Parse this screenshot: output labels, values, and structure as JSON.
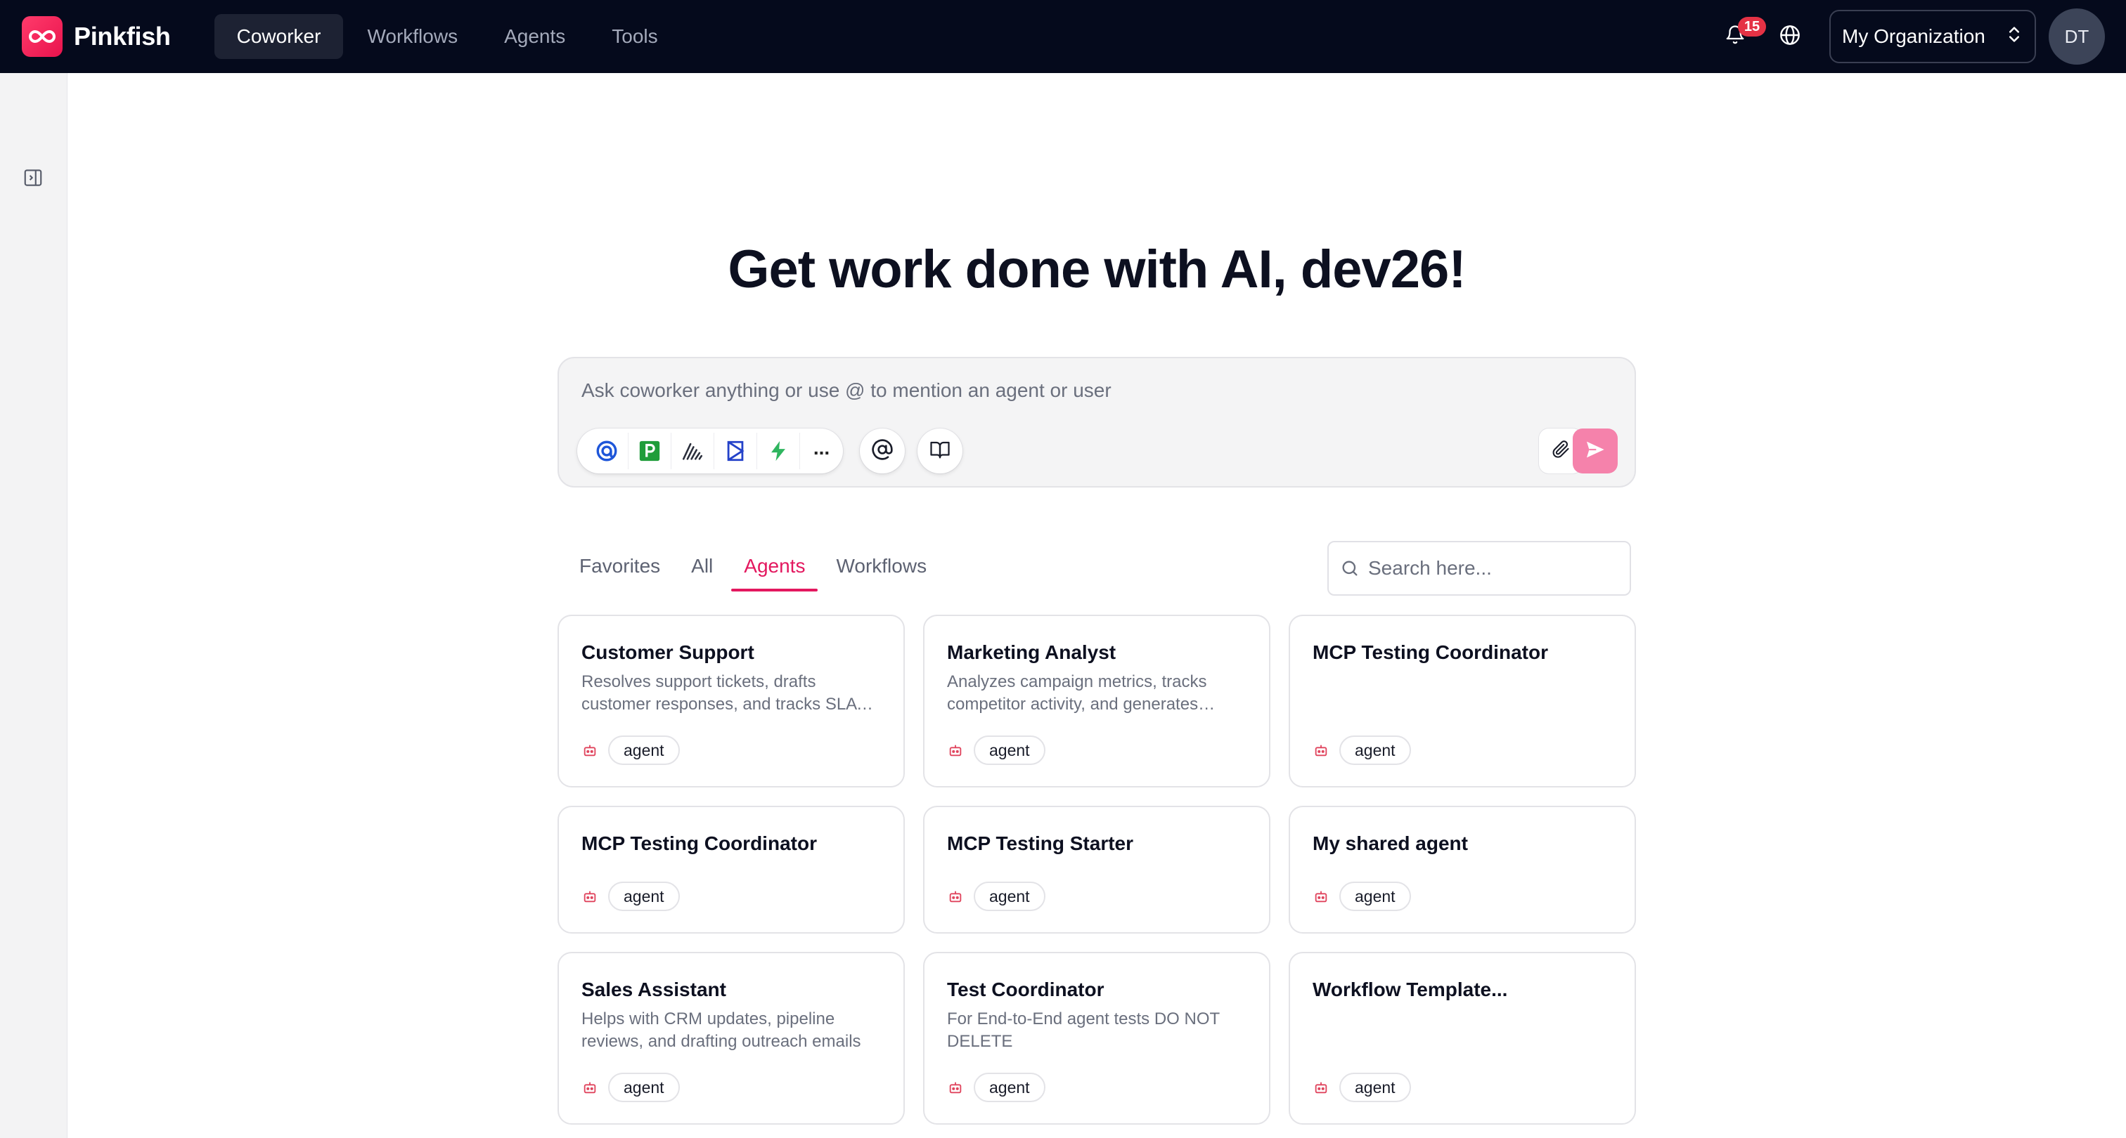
{
  "brand": {
    "name": "Pinkfish"
  },
  "nav": {
    "items": [
      {
        "label": "Coworker",
        "active": true
      },
      {
        "label": "Workflows",
        "active": false
      },
      {
        "label": "Agents",
        "active": false
      },
      {
        "label": "Tools",
        "active": false
      }
    ]
  },
  "header": {
    "notification_count": "15",
    "org_label": "My Organization",
    "avatar_initials": "DT"
  },
  "main": {
    "headline": "Get work done with AI, dev26!",
    "composer": {
      "placeholder": "Ask coworker anything or use @ to mention an agent or user",
      "more_label": "..."
    },
    "tabs": [
      {
        "label": "Favorites",
        "active": false
      },
      {
        "label": "All",
        "active": false
      },
      {
        "label": "Agents",
        "active": true
      },
      {
        "label": "Workflows",
        "active": false
      }
    ],
    "search": {
      "placeholder": "Search here..."
    },
    "cards": [
      {
        "title": "Customer Support",
        "description": "Resolves support tickets, drafts customer responses, and tracks SLA compliance",
        "tag": "agent"
      },
      {
        "title": "Marketing Analyst",
        "description": "Analyzes campaign metrics, tracks competitor activity, and generates reports",
        "tag": "agent"
      },
      {
        "title": "MCP Testing Coordinator",
        "description": "",
        "tag": "agent"
      },
      {
        "title": "MCP Testing Coordinator",
        "description": "",
        "tag": "agent"
      },
      {
        "title": "MCP Testing Starter",
        "description": "",
        "tag": "agent"
      },
      {
        "title": "My shared agent",
        "description": "",
        "tag": "agent"
      },
      {
        "title": "Sales Assistant",
        "description": "Helps with CRM updates, pipeline reviews, and drafting outreach emails",
        "tag": "agent"
      },
      {
        "title": "Test Coordinator",
        "description": "For End-to-End agent tests DO NOT DELETE",
        "tag": "agent"
      },
      {
        "title": "Workflow Template...",
        "description": "",
        "tag": "agent"
      }
    ]
  },
  "colors": {
    "topbar": "#050a1c",
    "accent": "#e3185f",
    "send_button": "#f582ab",
    "badge": "#e53245"
  },
  "icons": {
    "composer_tools": [
      "google-workspace-icon",
      "pipedrive-icon",
      "sales-stack-icon",
      "klaviyo-icon",
      "lightning-icon"
    ]
  }
}
